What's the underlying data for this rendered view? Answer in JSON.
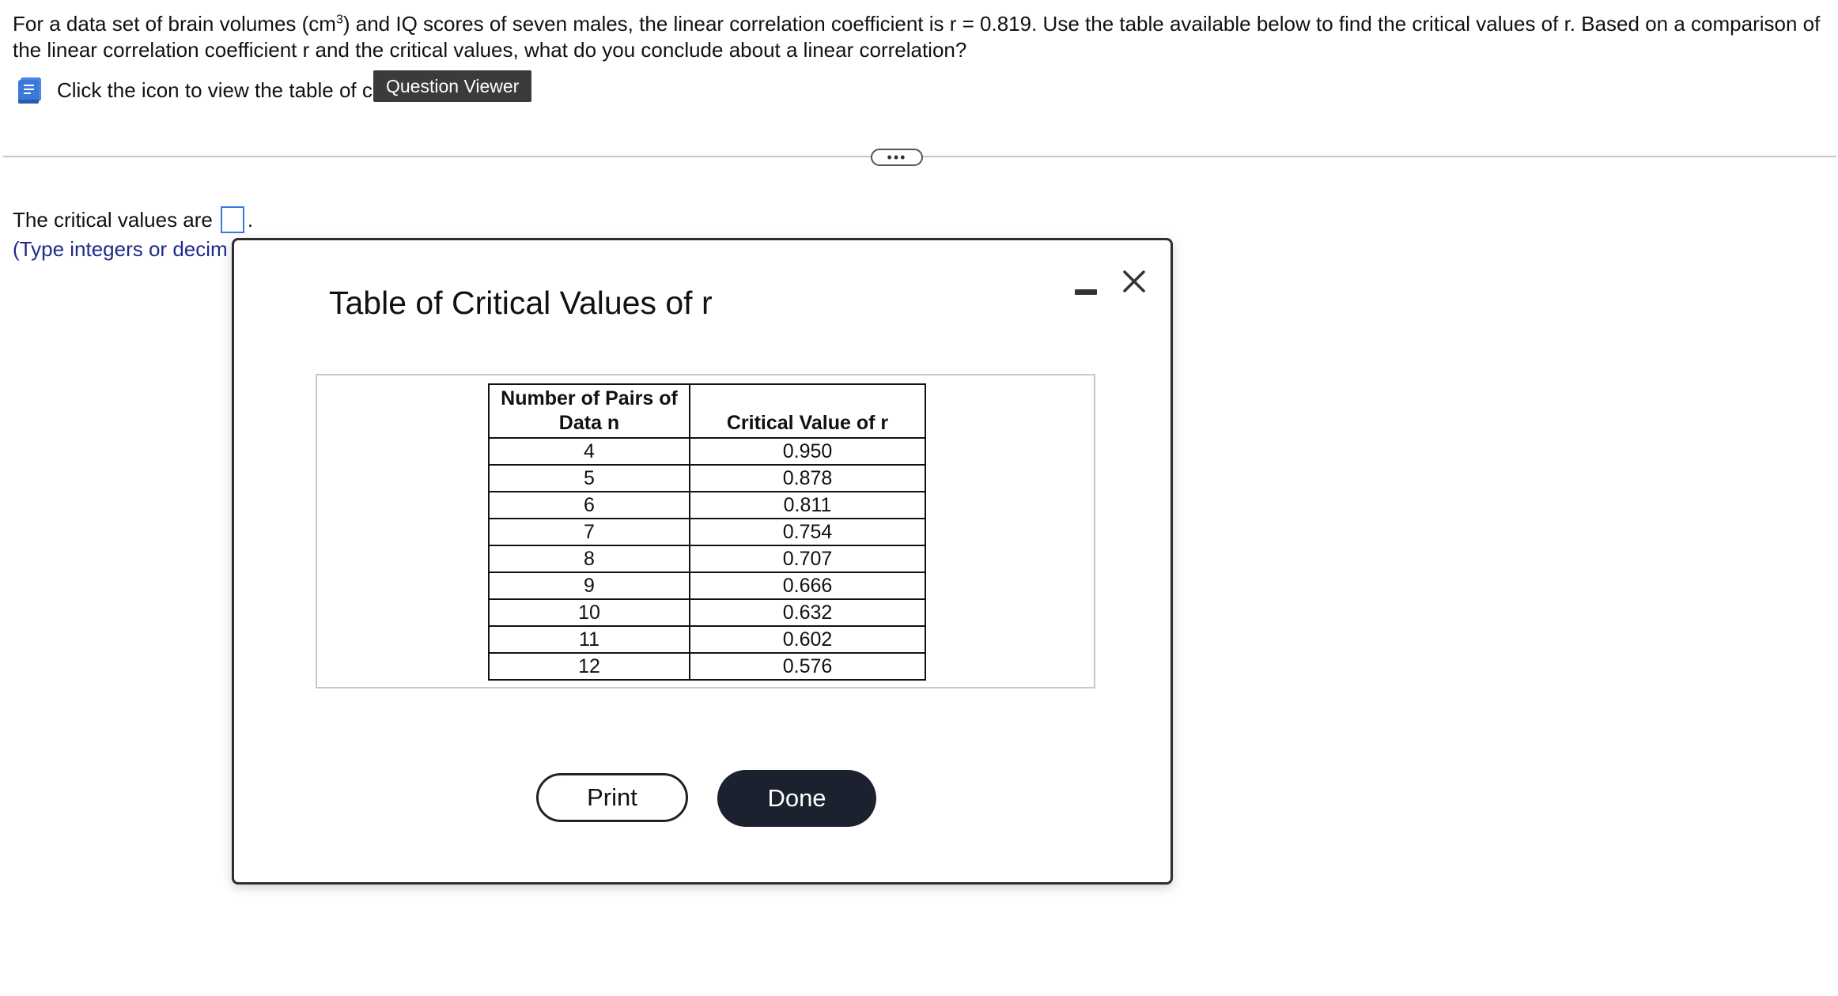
{
  "question": {
    "part1": "For a data set of brain volumes (cm",
    "sup": "3",
    "part2": ") and IQ scores of seven males, the linear correlation coefficient is r = 0.819. Use the table available below to find the critical values of r. Based on a comparison of the linear correlation coefficient r and the critical values, what do you conclude about a linear correlation?"
  },
  "hint": {
    "icon": "book-icon",
    "text": "Click the icon to view the table of c"
  },
  "tooltip": {
    "text": "Question Viewer"
  },
  "more": {
    "label": "•••"
  },
  "answer": {
    "label": "The critical values are",
    "suffix": ".",
    "instruction": "(Type integers or decim"
  },
  "modal": {
    "title": "Table of Critical Values of r",
    "minimize_icon": "minimize-icon",
    "close_icon": "close-icon",
    "table": {
      "headers": [
        "Number of Pairs of Data n",
        "Critical Value of r"
      ],
      "rows": [
        [
          "4",
          "0.950"
        ],
        [
          "5",
          "0.878"
        ],
        [
          "6",
          "0.811"
        ],
        [
          "7",
          "0.754"
        ],
        [
          "8",
          "0.707"
        ],
        [
          "9",
          "0.666"
        ],
        [
          "10",
          "0.632"
        ],
        [
          "11",
          "0.602"
        ],
        [
          "12",
          "0.576"
        ]
      ]
    },
    "print_label": "Print",
    "done_label": "Done"
  },
  "colors": {
    "accent": "#3c78d8",
    "done_bg": "#1c2130",
    "instruction_text": "#1f2a8c"
  }
}
